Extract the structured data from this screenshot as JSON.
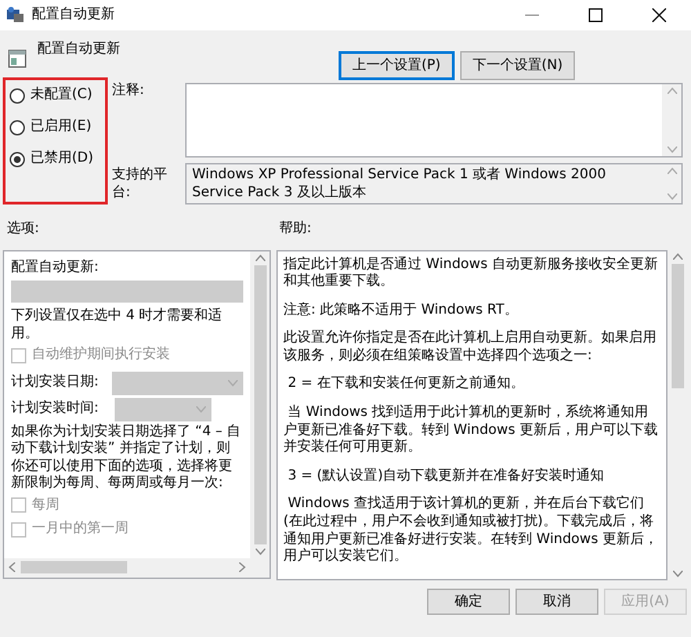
{
  "window": {
    "title": "配置自动更新"
  },
  "header": {
    "policy_name": "配置自动更新"
  },
  "nav_buttons": [
    {
      "label": "上一个设置(P)",
      "focused": true
    },
    {
      "label": "下一个设置(N)",
      "focused": false
    }
  ],
  "state_group": {
    "highlighted": true,
    "options": [
      {
        "label": "未配置(C)",
        "selected": false
      },
      {
        "label": "已启用(E)",
        "selected": false
      },
      {
        "label": "已禁用(D)",
        "selected": true
      }
    ]
  },
  "comment": {
    "label": "注释:"
  },
  "platform": {
    "label": "支持的平台:",
    "text": "Windows XP Professional Service Pack 1 或者 Windows 2000 Service Pack 3 及以上版本"
  },
  "options": {
    "label": "选项:",
    "items": [
      {
        "kind": "heading",
        "text": "配置自动更新:"
      },
      {
        "kind": "dropdown",
        "disabled": true
      },
      {
        "kind": "text",
        "text": "下列设置仅在选中 4 时才需要和适用。"
      },
      {
        "kind": "checkbox",
        "label": "自动维护期间执行安装",
        "checked": false,
        "disabled": true
      },
      {
        "kind": "select",
        "label": "计划安装日期:",
        "disabled": true
      },
      {
        "kind": "select",
        "label": "计划安装时间:",
        "disabled": true
      },
      {
        "kind": "text",
        "text": "如果你为计划安装日期选择了 “4 – 自动下载计划安装” 并指定了计划，则你还可以使用下面的选项，选择将更新限制为每周、每两周或每月一次:"
      },
      {
        "kind": "checkbox",
        "label": "每周",
        "checked": false,
        "disabled": true
      },
      {
        "kind": "checkbox",
        "label": "一月中的第一周",
        "checked": false,
        "disabled": true
      }
    ]
  },
  "help": {
    "label": "帮助:",
    "paragraphs": [
      "指定此计算机是否通过 Windows 自动更新服务接收安全更新和其他重要下载。",
      "注意: 此策略不适用于 Windows RT。",
      "此设置允许你指定是否在此计算机上启用自动更新。如果启用该服务，则必须在组策略设置中选择四个选项之一:",
      " 2 = 在下载和安装任何更新之前通知。",
      " 当 Windows 找到适用于此计算机的更新时，系统将通知用户更新已准备好下载。转到 Windows 更新后，用户可以下载并安装任何可用更新。",
      " 3 = (默认设置)自动下载更新并在准备好安装时通知",
      " Windows 查找适用于该计算机的更新，并在后台下载它们(在此过程中，用户不会收到通知或被打扰)。下载完成后，将通知用户更新已准备好进行安装。在转到 Windows 更新后，用户可以安装它们。"
    ]
  },
  "footer_buttons": [
    {
      "label": "确定",
      "disabled": false
    },
    {
      "label": "取消",
      "disabled": false
    },
    {
      "label": "应用(A)",
      "disabled": true
    }
  ]
}
